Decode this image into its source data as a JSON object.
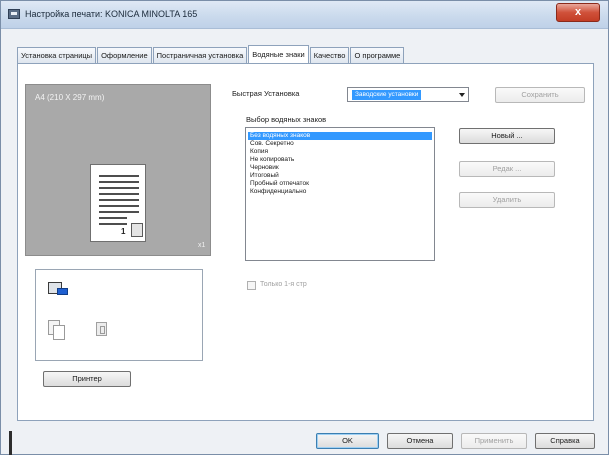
{
  "window": {
    "title": "Настройка печати: KONICA MINOLTA 165",
    "close_label": "x"
  },
  "tabs": [
    {
      "label": "Установка страницы",
      "active": false
    },
    {
      "label": "Оформление",
      "active": false
    },
    {
      "label": "Постраничная установка",
      "active": false
    },
    {
      "label": "Водяные знаки",
      "active": true
    },
    {
      "label": "Качество",
      "active": false
    },
    {
      "label": "О программе",
      "active": false
    }
  ],
  "preview": {
    "paper_size": "A4 (210 X 297 mm)",
    "sheet_number": "1",
    "copies": "x1"
  },
  "left_panel": {
    "printer_button": "Принтер"
  },
  "quick_setup": {
    "label": "Быстрая Установка",
    "value": "Заводские установки",
    "save_button": "Сохранить"
  },
  "watermarks": {
    "label": "Выбор водяных знаков",
    "items": [
      "Без водяных знаков",
      "Сов. Секретно",
      "Копия",
      "Не копировать",
      "Черновик",
      "Итоговый",
      "Пробный отпечаток",
      "Конфиденциально"
    ],
    "selected_index": 0,
    "new_button": "Новый ...",
    "edit_button": "Редак ...",
    "delete_button": "Удалить"
  },
  "first_page_only": {
    "label": "Только 1-я стр",
    "checked": false
  },
  "footer": {
    "ok": "OK",
    "cancel": "Отмена",
    "apply": "Применить",
    "help": "Справка"
  }
}
